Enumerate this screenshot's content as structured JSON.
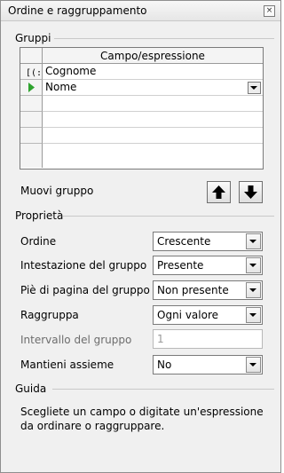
{
  "window": {
    "title": "Ordine e raggruppamento"
  },
  "groups": {
    "section_label": "Gruppi",
    "column_header": "Campo/espressione",
    "rows": [
      "Cognome",
      "Nome",
      "",
      "",
      "",
      ""
    ],
    "move_label": "Muovi gruppo"
  },
  "properties": {
    "section_label": "Proprietà",
    "ordine": {
      "label": "Ordine",
      "value": "Crescente"
    },
    "intestazione": {
      "label": "Intestazione del gruppo",
      "value": "Presente"
    },
    "pie_pagina": {
      "label": "Piè di pagina del gruppo",
      "value": "Non presente"
    },
    "raggruppa": {
      "label": "Raggruppa",
      "value": "Ogni valore"
    },
    "intervallo": {
      "label": "Intervallo del gruppo",
      "value": "1"
    },
    "mantieni": {
      "label": "Mantieni assieme",
      "value": "No"
    }
  },
  "help": {
    "section_label": "Guida",
    "text": "Scegliete un campo o digitate un'espressione da ordinare o raggruppare."
  },
  "icons": {
    "close": "close-icon",
    "sort_ascending": "sort-ascending-icon",
    "current_row": "current-row-arrow-icon",
    "move_up": "arrow-up-icon",
    "move_down": "arrow-down-icon"
  },
  "colors": {
    "current_row_arrow": "#2fa32f"
  }
}
